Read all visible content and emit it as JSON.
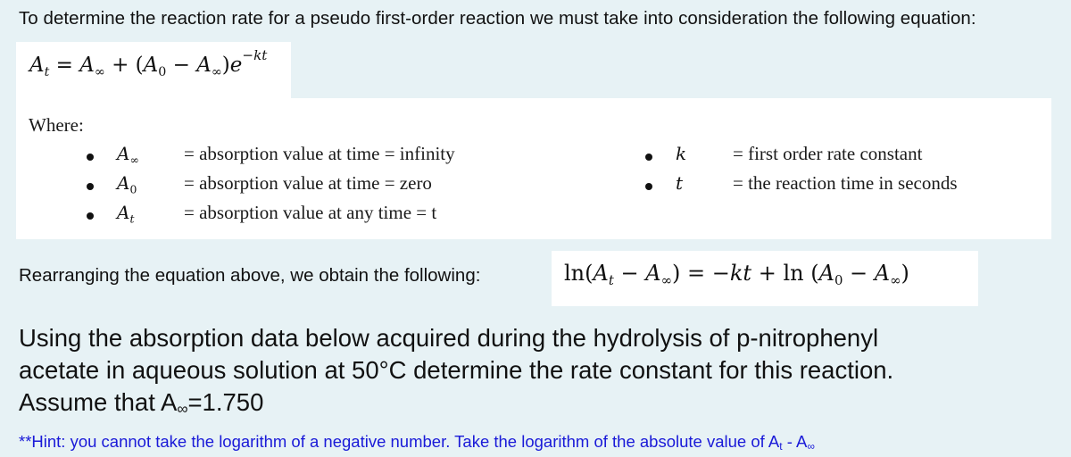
{
  "intro": {
    "text": "To determine the reaction rate for a pseudo first-order reaction we must take into consideration the following equation:"
  },
  "equation1": {
    "lhs_base": "A",
    "lhs_sub": "t",
    "equals": "=",
    "term1_base": "A",
    "term1_sub": "∞",
    "plus": "+",
    "open_paren": "(",
    "term2_base": "A",
    "term2_sub": "0",
    "minus": "−",
    "term3_base": "A",
    "term3_sub": "∞",
    "close_paren": ")",
    "exp_base": "e",
    "exp_power": "−kt"
  },
  "definitions": {
    "label": "Where:",
    "left": [
      {
        "symbol_base": "A",
        "symbol_sub": "∞",
        "text": "= absorption value at time = infinity"
      },
      {
        "symbol_base": "A",
        "symbol_sub": "0",
        "text": "= absorption value at time = zero"
      },
      {
        "symbol_base": "A",
        "symbol_sub": "t",
        "text": "= absorption value at any time = t"
      }
    ],
    "right": [
      {
        "symbol_base": "k",
        "symbol_sub": "",
        "text": "= first order rate constant"
      },
      {
        "symbol_base": "t",
        "symbol_sub": "",
        "text": "= the reaction time in seconds"
      }
    ]
  },
  "rearrange": {
    "text": "Rearranging the equation above, we obtain the following:"
  },
  "equation2": {
    "ln1": "ln",
    "open1": "(",
    "a1_base": "A",
    "a1_sub": "t",
    "minus1": "−",
    "a2_base": "A",
    "a2_sub": "∞",
    "close1": ")",
    "equals": "=",
    "neg_kt": "−kt",
    "plus": "+",
    "ln2": "ln",
    "open2": "(",
    "a3_base": "A",
    "a3_sub": "0",
    "minus2": "−",
    "a4_base": "A",
    "a4_sub": "∞",
    "close2": ")"
  },
  "question": {
    "line1": "Using the absorption data below acquired during the hydrolysis of p-nitrophenyl",
    "line2": "acetate in aqueous solution at 50°C determine the rate constant for this reaction.",
    "line3_prefix": "Assume that A",
    "line3_sub": "∞",
    "line3_suffix": "=1.750"
  },
  "hint": {
    "prefix": "**Hint: you cannot take the logarithm of a negative number. Take the logarithm of the absolute value of A",
    "sub1": "t",
    "middle": " - A",
    "sub2": "∞",
    "color": "#1a1ad8"
  }
}
